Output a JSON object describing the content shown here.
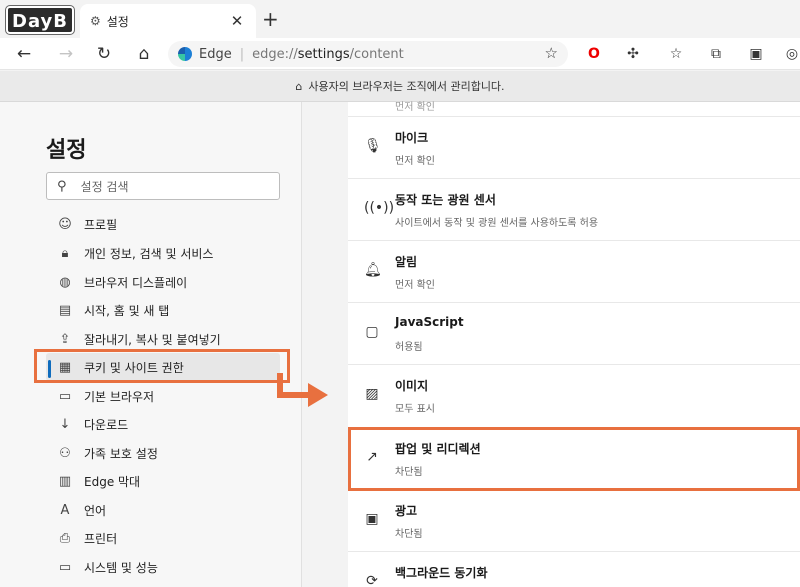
{
  "logo": {
    "text": "DayB"
  },
  "tab": {
    "title": "설정"
  },
  "toolbar": {
    "brand": "Edge",
    "url_host": "edge://",
    "url_path": "settings",
    "url_rest": "/content"
  },
  "managed_bar": {
    "text": "사용자의 브라우저는 조직에서 관리합니다."
  },
  "sidebar": {
    "title": "설정",
    "search_placeholder": "설정 검색",
    "items": [
      {
        "label": "프로필",
        "icon": "profile-icon"
      },
      {
        "label": "개인 정보, 검색 및 서비스",
        "icon": "privacy-lock-icon"
      },
      {
        "label": "브라우저 디스플레이",
        "icon": "palette-icon"
      },
      {
        "label": "시작, 홈 및 새 탭",
        "icon": "home-tab-icon"
      },
      {
        "label": "잘라내기, 복사 및 붙여넣기",
        "icon": "share-icon"
      },
      {
        "label": "쿠키 및 사이트 권한",
        "icon": "cookie-site-icon"
      },
      {
        "label": "기본 브라우저",
        "icon": "browser-icon"
      },
      {
        "label": "다운로드",
        "icon": "download-icon"
      },
      {
        "label": "가족 보호 설정",
        "icon": "family-icon"
      },
      {
        "label": "Edge 막대",
        "icon": "edge-bar-icon"
      },
      {
        "label": "언어",
        "icon": "language-icon"
      },
      {
        "label": "프린터",
        "icon": "printer-icon"
      },
      {
        "label": "시스템 및 성능",
        "icon": "system-icon"
      }
    ]
  },
  "content": {
    "cut_text": "먼저 확인",
    "rows": [
      {
        "title": "마이크",
        "subtitle": "먼저 확인",
        "icon": "microphone-icon"
      },
      {
        "title": "동작 또는 광원 센서",
        "subtitle": "사이트에서 동작 및 광원 센서를 사용하도록 허용",
        "icon": "sensor-icon"
      },
      {
        "title": "알림",
        "subtitle": "먼저 확인",
        "icon": "bell-icon"
      },
      {
        "title": "JavaScript",
        "subtitle": "허용됨",
        "icon": "javascript-icon"
      },
      {
        "title": "이미지",
        "subtitle": "모두 표시",
        "icon": "image-icon"
      },
      {
        "title": "팝업 및 리디렉션",
        "subtitle": "차단됨",
        "icon": "popup-icon"
      },
      {
        "title": "광고",
        "subtitle": "차단됨",
        "icon": "ads-icon"
      },
      {
        "title": "백그라운드 동기화",
        "subtitle": "",
        "icon": "sync-icon"
      }
    ]
  },
  "colors": {
    "accent": "#0f6cbd",
    "annotation": "#e8703f"
  }
}
